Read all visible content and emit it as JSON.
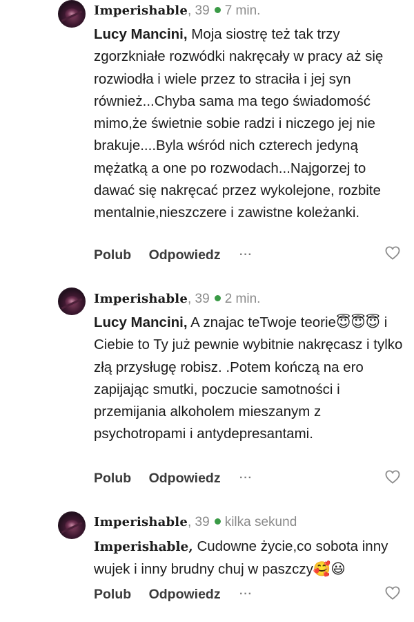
{
  "comments": [
    {
      "author": "Imperishable",
      "meta": ", 39",
      "time": "7 min.",
      "mention": "Lucy Mancini,",
      "text": " Moja siostrę też tak trzy zgorzkniałe rozwódki nakręcały w pracy aż się rozwiodła i wiele przez to straciła i jej syn również...Chyba sama ma tego świadomość mimo,że świetnie sobie radzi i niczego jej nie brakuje....Byla wśród nich czterech jedyną mężatką a one po rozwodach...Najgorzej to dawać się nakręcać przez wykolejone, rozbite mentalnie,nieszczere i zawistne koleżanki.",
      "emoji": "",
      "like_label": "Polub",
      "reply_label": "Odpowiedz",
      "more_label": "···"
    },
    {
      "author": "Imperishable",
      "meta": ", 39",
      "time": "2 min.",
      "mention": "Lucy Mancini,",
      "text": " A znajac teTwoje teorie😇😇😇 i Ciebie to Ty już pewnie wybitnie nakręcasz i tylko złą przysługę robisz. .Potem kończą na ero zapijając smutki, poczucie samotności i przemijania alkoholem mieszanym z psychotropami i antydepresantami.",
      "emoji": "",
      "like_label": "Polub",
      "reply_label": "Odpowiedz",
      "more_label": "···"
    },
    {
      "author": "Imperishable",
      "meta": ", 39",
      "time": "kilka sekund",
      "mention": "Imperishable,",
      "text": " Cudowne życie,co sobota inny wujek i inny brudny chuj w paszczy🥰😃",
      "emoji": "",
      "like_label": "Polub",
      "reply_label": "Odpowiedz",
      "more_label": "···"
    }
  ],
  "colors": {
    "online_dot": "#3a9a46",
    "meta_text": "#8a8a8a",
    "body_text": "#1c1c1c"
  },
  "icons": {
    "like": "heart-outline-icon",
    "more": "more-dots-icon",
    "online": "online-status-dot"
  }
}
